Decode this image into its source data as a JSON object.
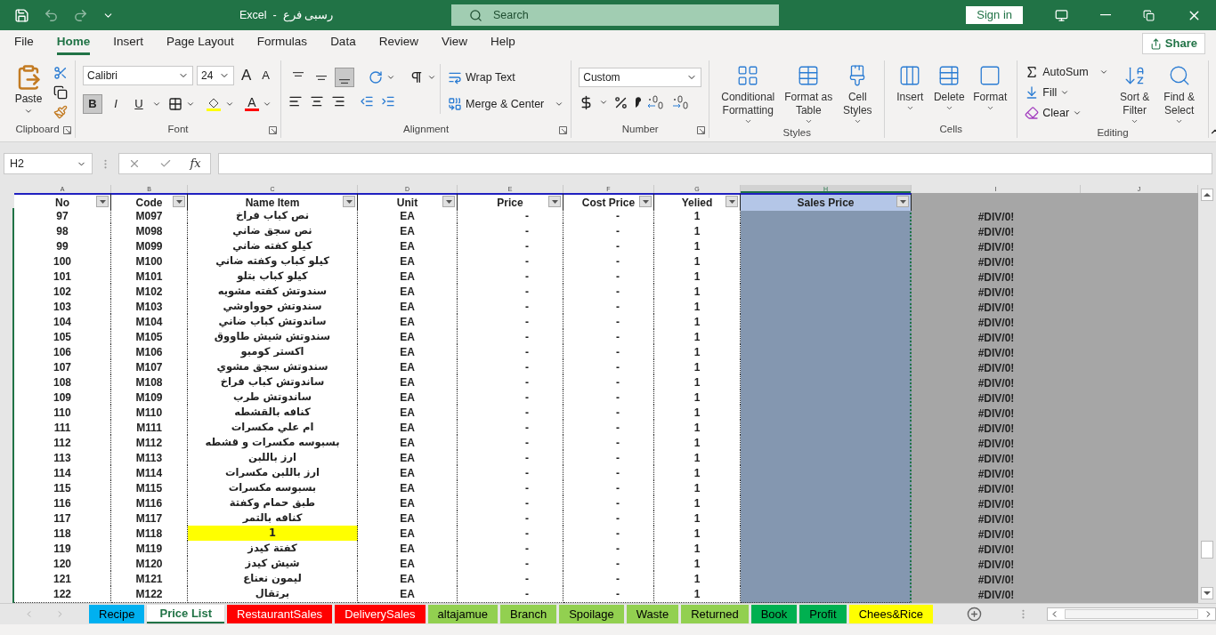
{
  "window": {
    "title": "رسبى فرع  -  Excel",
    "search": "Search",
    "sign_in": "Sign in"
  },
  "menu_tabs": [
    {
      "label": "File",
      "selected": false
    },
    {
      "label": "Home",
      "selected": true
    },
    {
      "label": "Insert",
      "selected": false
    },
    {
      "label": "Page Layout",
      "selected": false
    },
    {
      "label": "Formulas",
      "selected": false
    },
    {
      "label": "Data",
      "selected": false
    },
    {
      "label": "Review",
      "selected": false
    },
    {
      "label": "View",
      "selected": false
    },
    {
      "label": "Help",
      "selected": false
    }
  ],
  "share": "Share",
  "ribbon": {
    "clipboard": {
      "paste": "Paste",
      "label": "Clipboard"
    },
    "font": {
      "name": "Calibri",
      "size": "24",
      "grow": "A",
      "shrink": "A",
      "color_letter": "A",
      "label": "Font",
      "styles": [
        {
          "label": "B",
          "selected": true
        },
        {
          "label": "I",
          "selected": false
        },
        {
          "label": "U",
          "selected": false
        }
      ]
    },
    "alignment": {
      "vertical_align": [
        {
          "selected": false
        },
        {
          "selected": false
        },
        {
          "selected": true
        }
      ],
      "wrap": "Wrap Text",
      "merge": "Merge & Center",
      "label": "Alignment"
    },
    "number": {
      "format": "Custom",
      "label": "Number"
    },
    "styles": {
      "conditional": "Conditional Formatting",
      "format_table": "Format as Table",
      "cell_styles": "Cell Styles",
      "label": "Styles"
    },
    "cells": {
      "insert": "Insert",
      "delete": "Delete",
      "format": "Format",
      "label": "Cells"
    },
    "editing": {
      "autosum": "AutoSum",
      "fill": "Fill",
      "clear": "Clear",
      "sort": "Sort & Filter",
      "find": "Find & Select",
      "label": "Editing"
    }
  },
  "formula_bar": {
    "name_box": "H2",
    "fx": "fx"
  },
  "table": {
    "columns": [
      {
        "letter": "A",
        "label": "No",
        "selected": false
      },
      {
        "letter": "B",
        "label": "Code",
        "selected": false
      },
      {
        "letter": "C",
        "label": "Name Item",
        "selected": false
      },
      {
        "letter": "D",
        "label": "Unit",
        "selected": false
      },
      {
        "letter": "E",
        "label": "Price",
        "selected": false
      },
      {
        "letter": "F",
        "label": "Cost Price",
        "selected": false
      },
      {
        "letter": "G",
        "label": "Yelied",
        "selected": false
      },
      {
        "letter": "H",
        "label": "Sales Price",
        "selected": true
      },
      {
        "letter": "I",
        "selected": false
      },
      {
        "letter": "J",
        "selected": false
      }
    ],
    "rows": [
      {
        "no": "97",
        "code": "M097",
        "name": "نص كباب فراخ",
        "unit": "EA",
        "price": "-",
        "cost_price": "-",
        "yelied": "1",
        "column_9": "#DIV/0!",
        "highlighted": false
      },
      {
        "no": "98",
        "code": "M098",
        "name": "نص سجق ضاني",
        "unit": "EA",
        "price": "-",
        "cost_price": "-",
        "yelied": "1",
        "column_9": "#DIV/0!",
        "highlighted": false
      },
      {
        "no": "99",
        "code": "M099",
        "name": "كيلو كفته ضاني",
        "unit": "EA",
        "price": "-",
        "cost_price": "-",
        "yelied": "1",
        "column_9": "#DIV/0!",
        "highlighted": false
      },
      {
        "no": "100",
        "code": "M100",
        "name": "كيلو كباب وكفته ضاني",
        "unit": "EA",
        "price": "-",
        "cost_price": "-",
        "yelied": "1",
        "column_9": "#DIV/0!",
        "highlighted": false
      },
      {
        "no": "101",
        "code": "M101",
        "name": "كيلو كباب بتلو",
        "unit": "EA",
        "price": "-",
        "cost_price": "-",
        "yelied": "1",
        "column_9": "#DIV/0!",
        "highlighted": false
      },
      {
        "no": "102",
        "code": "M102",
        "name": "سندوتش كفته مشويه",
        "unit": "EA",
        "price": "-",
        "cost_price": "-",
        "yelied": "1",
        "column_9": "#DIV/0!",
        "highlighted": false
      },
      {
        "no": "103",
        "code": "M103",
        "name": "سندوتش حوواوشي",
        "unit": "EA",
        "price": "-",
        "cost_price": "-",
        "yelied": "1",
        "column_9": "#DIV/0!",
        "highlighted": false
      },
      {
        "no": "104",
        "code": "M104",
        "name": "ساندوتش كباب ضاني",
        "unit": "EA",
        "price": "-",
        "cost_price": "-",
        "yelied": "1",
        "column_9": "#DIV/0!",
        "highlighted": false
      },
      {
        "no": "105",
        "code": "M105",
        "name": "سندوتش شيش طاووق",
        "unit": "EA",
        "price": "-",
        "cost_price": "-",
        "yelied": "1",
        "column_9": "#DIV/0!",
        "highlighted": false
      },
      {
        "no": "106",
        "code": "M106",
        "name": "اكستر كومبو",
        "unit": "EA",
        "price": "-",
        "cost_price": "-",
        "yelied": "1",
        "column_9": "#DIV/0!",
        "highlighted": false
      },
      {
        "no": "107",
        "code": "M107",
        "name": "سندوتش سجق مشوي",
        "unit": "EA",
        "price": "-",
        "cost_price": "-",
        "yelied": "1",
        "column_9": "#DIV/0!",
        "highlighted": false
      },
      {
        "no": "108",
        "code": "M108",
        "name": "ساندوتش كباب فراخ",
        "unit": "EA",
        "price": "-",
        "cost_price": "-",
        "yelied": "1",
        "column_9": "#DIV/0!",
        "highlighted": false
      },
      {
        "no": "109",
        "code": "M109",
        "name": "ساندوتش طرب",
        "unit": "EA",
        "price": "-",
        "cost_price": "-",
        "yelied": "1",
        "column_9": "#DIV/0!",
        "highlighted": false
      },
      {
        "no": "110",
        "code": "M110",
        "name": "كنافه بالقشطه",
        "unit": "EA",
        "price": "-",
        "cost_price": "-",
        "yelied": "1",
        "column_9": "#DIV/0!",
        "highlighted": false
      },
      {
        "no": "111",
        "code": "M111",
        "name": "ام علي مكسرات",
        "unit": "EA",
        "price": "-",
        "cost_price": "-",
        "yelied": "1",
        "column_9": "#DIV/0!",
        "highlighted": false
      },
      {
        "no": "112",
        "code": "M112",
        "name": "بسبوسه مكسرات و قشطه",
        "unit": "EA",
        "price": "-",
        "cost_price": "-",
        "yelied": "1",
        "column_9": "#DIV/0!",
        "highlighted": false
      },
      {
        "no": "113",
        "code": "M113",
        "name": "ارز باللبن",
        "unit": "EA",
        "price": "-",
        "cost_price": "-",
        "yelied": "1",
        "column_9": "#DIV/0!",
        "highlighted": false
      },
      {
        "no": "114",
        "code": "M114",
        "name": "ارز باللبن مكسرات",
        "unit": "EA",
        "price": "-",
        "cost_price": "-",
        "yelied": "1",
        "column_9": "#DIV/0!",
        "highlighted": false
      },
      {
        "no": "115",
        "code": "M115",
        "name": "بسبوسه مكسرات",
        "unit": "EA",
        "price": "-",
        "cost_price": "-",
        "yelied": "1",
        "column_9": "#DIV/0!",
        "highlighted": false
      },
      {
        "no": "116",
        "code": "M116",
        "name": "طبق حمام وكفتة",
        "unit": "EA",
        "price": "-",
        "cost_price": "-",
        "yelied": "1",
        "column_9": "#DIV/0!",
        "highlighted": false
      },
      {
        "no": "117",
        "code": "M117",
        "name": "كنافه بالتمر",
        "unit": "EA",
        "price": "-",
        "cost_price": "-",
        "yelied": "1",
        "column_9": "#DIV/0!",
        "highlighted": false
      },
      {
        "no": "118",
        "code": "M118",
        "name": "1",
        "unit": "EA",
        "price": "-",
        "cost_price": "-",
        "yelied": "1",
        "column_9": "#DIV/0!",
        "highlighted": true
      },
      {
        "no": "119",
        "code": "M119",
        "name": "كفتة كيدز",
        "unit": "EA",
        "price": "-",
        "cost_price": "-",
        "yelied": "1",
        "column_9": "#DIV/0!",
        "highlighted": false
      },
      {
        "no": "120",
        "code": "M120",
        "name": "شيش كيدز",
        "unit": "EA",
        "price": "-",
        "cost_price": "-",
        "yelied": "1",
        "column_9": "#DIV/0!",
        "highlighted": false
      },
      {
        "no": "121",
        "code": "M121",
        "name": "ليمون نعناع",
        "unit": "EA",
        "price": "-",
        "cost_price": "-",
        "yelied": "1",
        "column_9": "#DIV/0!",
        "highlighted": false
      },
      {
        "no": "122",
        "code": "M122",
        "name": "برتقال",
        "unit": "EA",
        "price": "-",
        "cost_price": "-",
        "yelied": "1",
        "column_9": "#DIV/0!",
        "highlighted": false
      }
    ]
  },
  "sheet_tabs": [
    {
      "label": "Recipe",
      "color": "#00b0f0",
      "selected": false
    },
    {
      "label": "Price List",
      "color": "#ffffff",
      "selected": true
    },
    {
      "label": "RestaurantSales",
      "color": "#ff0000",
      "selected": false
    },
    {
      "label": "DeliverySales",
      "color": "#ff0000",
      "selected": false
    },
    {
      "label": "altajamue",
      "color": "#92d050",
      "selected": false
    },
    {
      "label": "Branch",
      "color": "#92d050",
      "selected": false
    },
    {
      "label": "Spoilage",
      "color": "#92d050",
      "selected": false
    },
    {
      "label": "Waste",
      "color": "#92d050",
      "selected": false
    },
    {
      "label": "Returned",
      "color": "#92d050",
      "selected": false
    },
    {
      "label": "Book",
      "color": "#00b050",
      "selected": false
    },
    {
      "label": "Profit",
      "color": "#00b050",
      "selected": false
    },
    {
      "label": "Chees&Rice",
      "color": "#ffff00",
      "selected": false
    }
  ]
}
